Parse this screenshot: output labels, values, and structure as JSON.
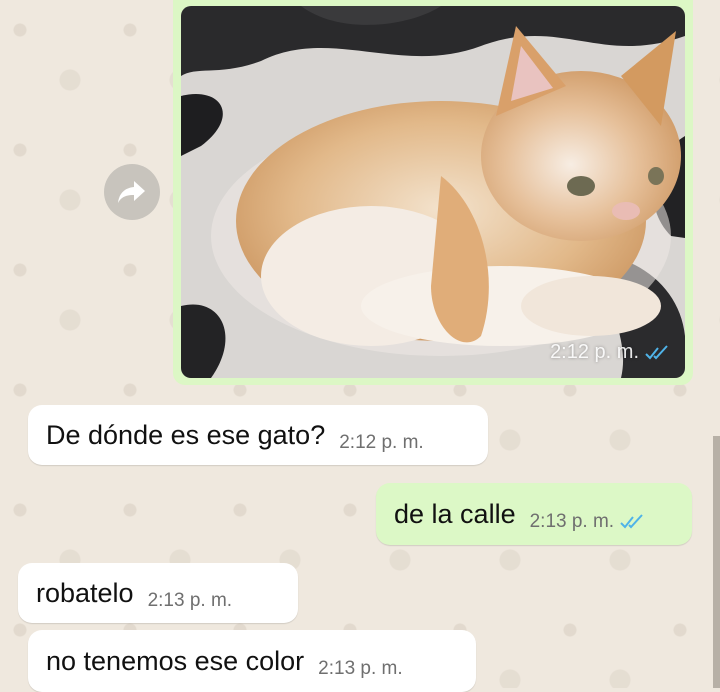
{
  "image_message": {
    "time": "2:12 p. m.",
    "status": "read",
    "alt": "orange and white kitten"
  },
  "messages": [
    {
      "text": "De dónde es ese gato?",
      "time": "2:12 p. m.",
      "direction": "in"
    },
    {
      "text": "de la calle",
      "time": "2:13 p. m.",
      "direction": "out",
      "status": "read"
    },
    {
      "text": "robatelo",
      "time": "2:13 p. m.",
      "direction": "in"
    },
    {
      "text": "no tenemos ese color",
      "time": "2:13 p. m.",
      "direction": "in"
    }
  ],
  "colors": {
    "wallpaper": "#efe8de",
    "outgoing": "#dcf8c6",
    "incoming": "#ffffff",
    "read_ticks": "#4fb3e8"
  },
  "icons": {
    "forward": "forward-arrow-icon",
    "read": "double-check-icon"
  }
}
